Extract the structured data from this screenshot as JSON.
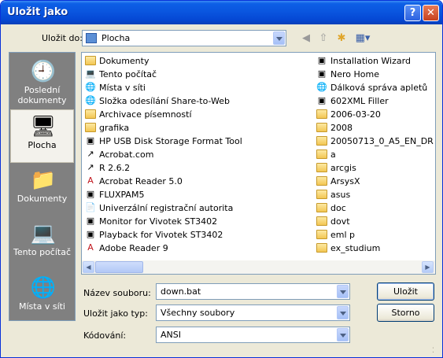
{
  "titlebar": {
    "title": "Uložit jako",
    "help_label": "?",
    "close_label": "✕"
  },
  "savein": {
    "label": "Uložit do:",
    "value": "Plocha"
  },
  "toolbar": {
    "back_icon": "back-icon",
    "up_icon": "up-folder-icon",
    "newfolder_icon": "new-folder-icon",
    "views_icon": "views-menu-icon"
  },
  "places": [
    {
      "label": "Poslední\ndokumenty",
      "icon": "recent-documents-icon"
    },
    {
      "label": "Plocha",
      "icon": "desktop-icon",
      "selected": true
    },
    {
      "label": "Dokumenty",
      "icon": "my-documents-icon"
    },
    {
      "label": "Tento počítač",
      "icon": "my-computer-icon"
    },
    {
      "label": "Místa v síti",
      "icon": "network-places-icon"
    }
  ],
  "files_col1": [
    {
      "name": "Dokumenty",
      "icon": "folder"
    },
    {
      "name": "Tento počítač",
      "icon": "computer"
    },
    {
      "name": "Místa v síti",
      "icon": "network"
    },
    {
      "name": "Složka odesílání Share-to-Web",
      "icon": "web"
    },
    {
      "name": "Archivace písemností",
      "icon": "folder"
    },
    {
      "name": "grafika",
      "icon": "folder"
    },
    {
      "name": "HP USB Disk Storage Format Tool",
      "icon": "app"
    },
    {
      "name": "Acrobat.com",
      "icon": "shortcut"
    },
    {
      "name": "R 2.6.2",
      "icon": "shortcut"
    },
    {
      "name": "Acrobat Reader 5.0",
      "icon": "pdf"
    },
    {
      "name": "FLUXPAM5",
      "icon": "app"
    },
    {
      "name": "Univerzální registrační autorita",
      "icon": "doc"
    },
    {
      "name": "Monitor for Vivotek ST3402",
      "icon": "app"
    },
    {
      "name": "Playback for Vivotek ST3402",
      "icon": "app"
    },
    {
      "name": "Adobe Reader 9",
      "icon": "pdf"
    }
  ],
  "files_col2": [
    {
      "name": "Installation Wizard",
      "icon": "app"
    },
    {
      "name": "Nero Home",
      "icon": "app"
    },
    {
      "name": "Dálková správa apletů",
      "icon": "web"
    },
    {
      "name": "602XML Filler",
      "icon": "app"
    },
    {
      "name": "2006-03-20",
      "icon": "folder"
    },
    {
      "name": "2008",
      "icon": "folder"
    },
    {
      "name": "20050713_0_A5_EN_DR",
      "icon": "folder"
    },
    {
      "name": "a",
      "icon": "folder"
    },
    {
      "name": "arcgis",
      "icon": "folder"
    },
    {
      "name": "ArsysX",
      "icon": "folder"
    },
    {
      "name": "asus",
      "icon": "folder"
    },
    {
      "name": "doc",
      "icon": "folder"
    },
    {
      "name": "dovt",
      "icon": "folder"
    },
    {
      "name": "eml p",
      "icon": "folder"
    },
    {
      "name": "ex_studium",
      "icon": "folder"
    }
  ],
  "form": {
    "filename_label": "Název souboru:",
    "filename_value": "down.bat",
    "filetype_label": "Uložit jako typ:",
    "filetype_value": "Všechny soubory",
    "encoding_label": "Kódování:",
    "encoding_value": "ANSI"
  },
  "buttons": {
    "save": "Uložit",
    "cancel": "Storno"
  }
}
